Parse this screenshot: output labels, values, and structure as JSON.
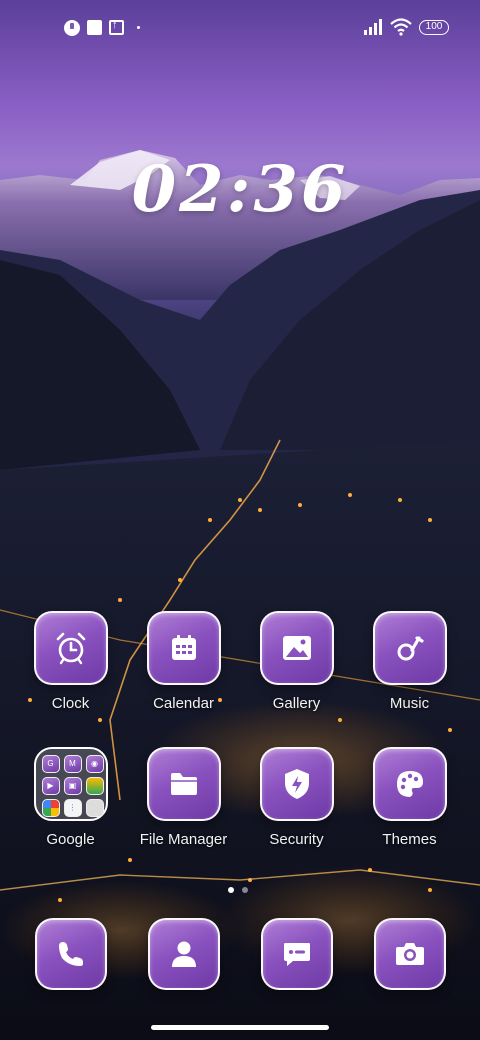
{
  "status_bar": {
    "battery": "100",
    "left_icons": [
      "app-notification-icon",
      "square-notification-icon",
      "upload-notification-icon",
      "more-dot-icon"
    ],
    "right_icons": [
      "signal-icon",
      "wifi-icon",
      "battery-icon"
    ]
  },
  "clock": {
    "time": "02:36"
  },
  "apps_row1": [
    {
      "label": "Clock",
      "icon": "alarm-clock-icon"
    },
    {
      "label": "Calendar",
      "icon": "calendar-icon"
    },
    {
      "label": "Gallery",
      "icon": "image-icon"
    },
    {
      "label": "Music",
      "icon": "music-note-icon"
    }
  ],
  "apps_row2": [
    {
      "label": "Google",
      "icon": "folder-icon"
    },
    {
      "label": "File Manager",
      "icon": "folder-icon"
    },
    {
      "label": "Security",
      "icon": "shield-icon"
    },
    {
      "label": "Themes",
      "icon": "palette-icon"
    }
  ],
  "dock": [
    {
      "icon": "phone-icon"
    },
    {
      "icon": "contacts-icon"
    },
    {
      "icon": "message-icon"
    },
    {
      "icon": "camera-icon"
    }
  ],
  "pages": {
    "count": 2,
    "current": 1
  },
  "colors": {
    "accent": "#8a52bf",
    "icon_light": "#b07ed6",
    "icon_dark": "#6e3aa6"
  }
}
